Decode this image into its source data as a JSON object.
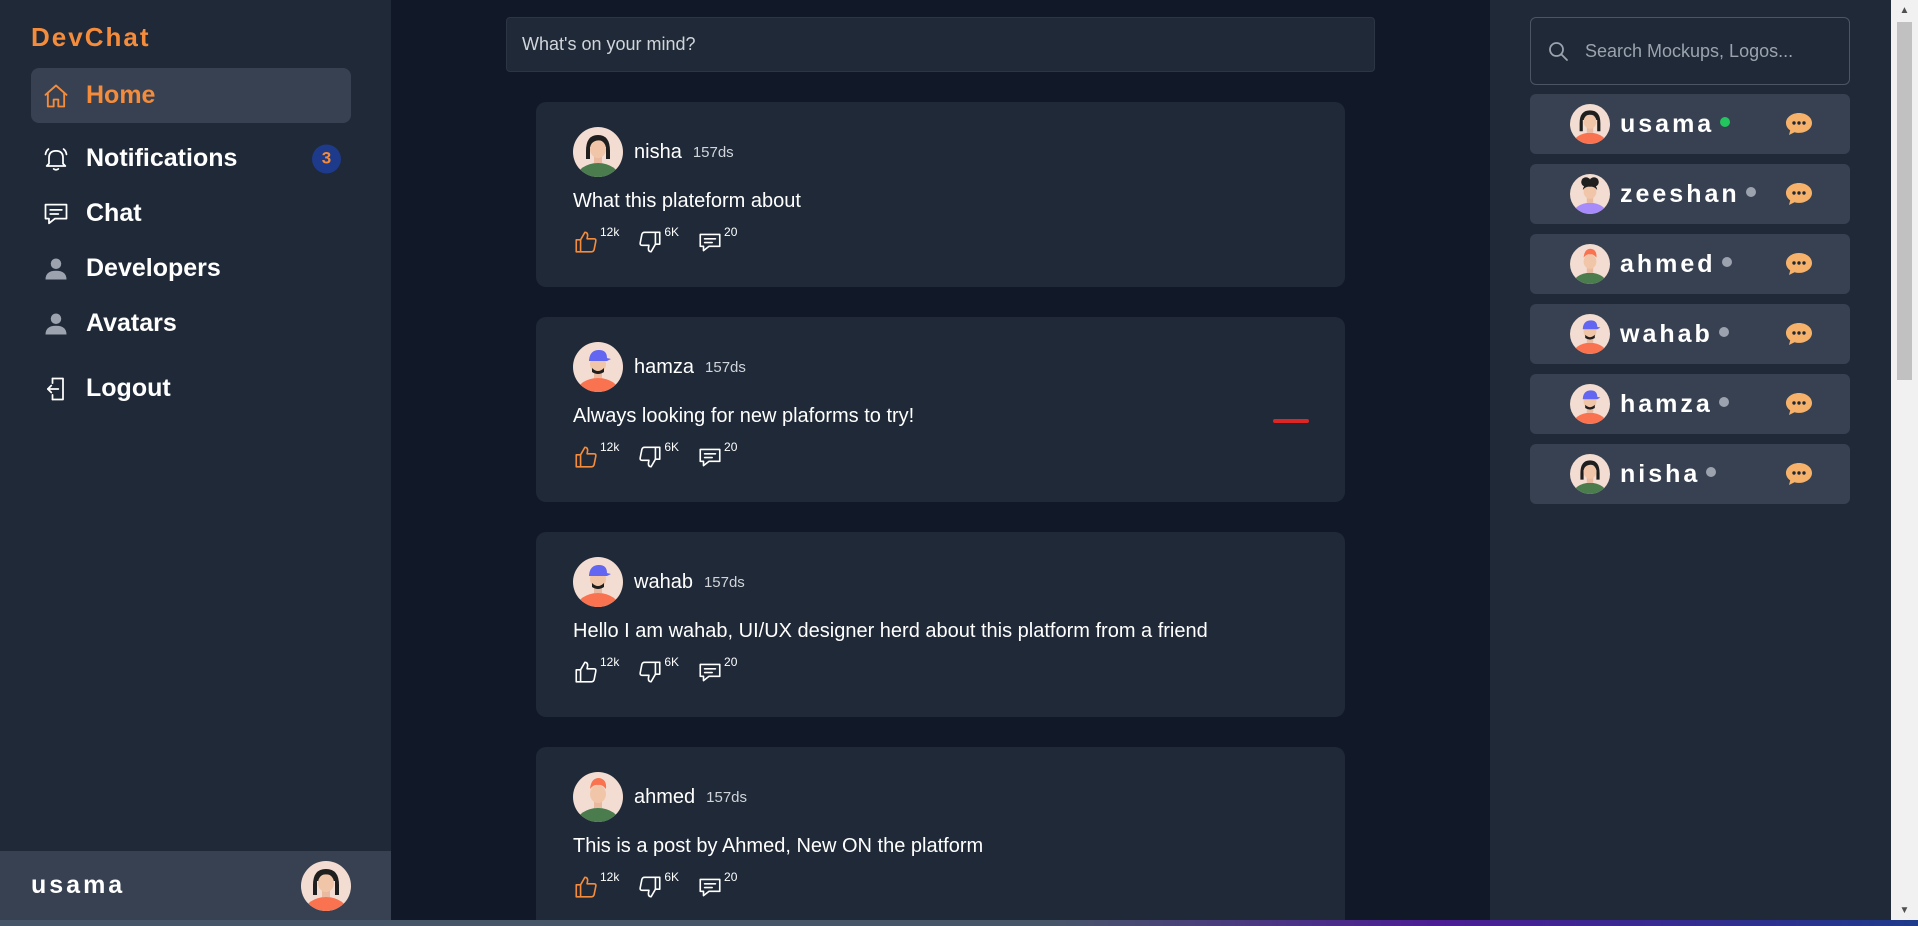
{
  "brand": "DevChat",
  "nav": {
    "home": "Home",
    "notifications": "Notifications",
    "notifications_badge": "3",
    "chat": "Chat",
    "developers": "Developers",
    "avatars": "Avatars",
    "logout": "Logout"
  },
  "current_user": {
    "name": "usama"
  },
  "composer": {
    "placeholder": "What's on your mind?"
  },
  "posts": [
    {
      "author": "nisha",
      "time": "157ds",
      "text": "What this plateform about",
      "likes": "12k",
      "dislikes": "6K",
      "comments": "20"
    },
    {
      "author": "hamza",
      "time": "157ds",
      "text": "Always looking for new plaforms to try!",
      "likes": "12k",
      "dislikes": "6K",
      "comments": "20"
    },
    {
      "author": "wahab",
      "time": "157ds",
      "text": "Hello I am wahab, UI/UX designer herd about this platform from a friend",
      "likes": "12k",
      "dislikes": "6K",
      "comments": "20"
    },
    {
      "author": "ahmed",
      "time": "157ds",
      "text": "This is a post by Ahmed, New ON the platform",
      "likes": "12k",
      "dislikes": "6K",
      "comments": "20"
    }
  ],
  "search": {
    "placeholder": "Search Mockups, Logos..."
  },
  "contacts": [
    {
      "name": "usama",
      "status": "online"
    },
    {
      "name": "zeeshan",
      "status": "offline"
    },
    {
      "name": "ahmed",
      "status": "offline"
    },
    {
      "name": "wahab",
      "status": "offline"
    },
    {
      "name": "hamza",
      "status": "offline"
    },
    {
      "name": "nisha",
      "status": "offline"
    }
  ],
  "colors": {
    "accent": "#f48c3c",
    "online": "#22c55e",
    "offline": "#9ca3af",
    "panel": "#1f2937",
    "background": "#111827"
  }
}
